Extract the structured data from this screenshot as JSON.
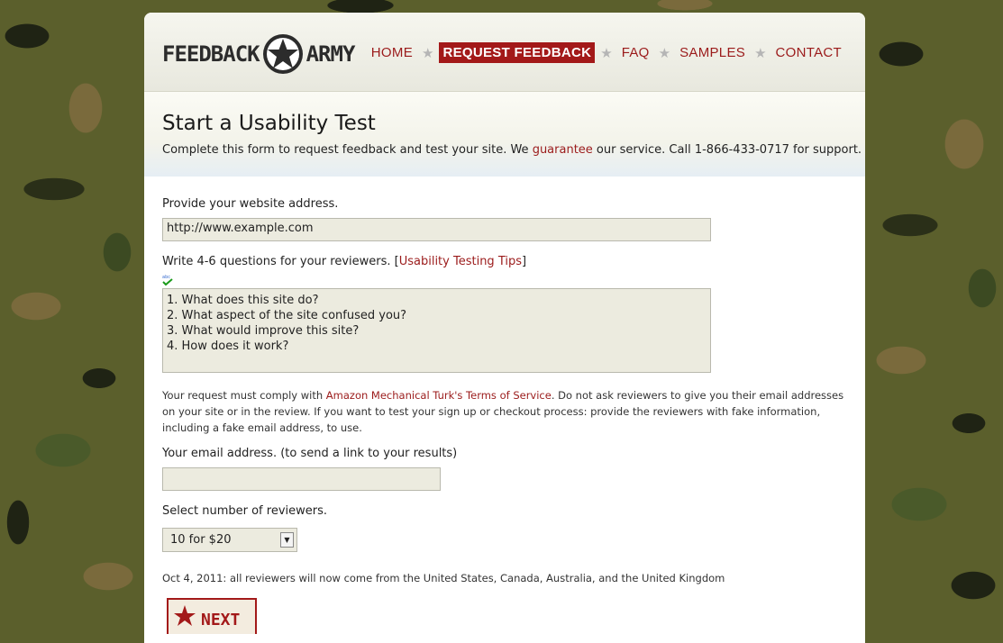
{
  "header": {
    "logo": {
      "left_text": "FEEDBACK",
      "right_text": "ARMY"
    },
    "nav": [
      {
        "label": "HOME",
        "active": false
      },
      {
        "label": "REQUEST FEEDBACK",
        "active": true
      },
      {
        "label": "FAQ",
        "active": false
      },
      {
        "label": "SAMPLES",
        "active": false
      },
      {
        "label": "CONTACT",
        "active": false
      }
    ]
  },
  "intro": {
    "title": "Start a Usability Test",
    "text_before": "Complete this form to request feedback and test your site. We ",
    "guarantee_link": "guarantee",
    "text_after": " our service. Call 1-866-433-0717 for support."
  },
  "form": {
    "website_label": "Provide your website address.",
    "website_value": "http://www.example.com",
    "questions_label": "Write 4-6 questions for your reviewers. [",
    "tips_link": "Usability Testing Tips",
    "questions_label_end": "]",
    "spellcheck_icon": "abc",
    "questions_value": "1. What does this site do?\n2. What aspect of the site confused you?\n3. What would improve this site?\n4. How does it work?",
    "notice_before": "Your request must comply with ",
    "terms_link": "Amazon Mechanical Turk's Terms of Service",
    "notice_after": ". Do not ask reviewers to give you their email addresses on your site or in the review. If you want to test your sign up or checkout process: provide the reviewers with fake information, including a fake email address, to use.",
    "email_label": "Your email address. (to send a link to your results)",
    "email_value": "",
    "reviewers_label": "Select number of reviewers.",
    "reviewers_selected": "10 for $20",
    "update_note": "Oct 4, 2011: all reviewers will now come from the United States, Canada, Australia, and the United Kingdom",
    "next_button": "NEXT"
  },
  "colors": {
    "accent": "#a31919",
    "field_bg": "#ecebdf"
  }
}
